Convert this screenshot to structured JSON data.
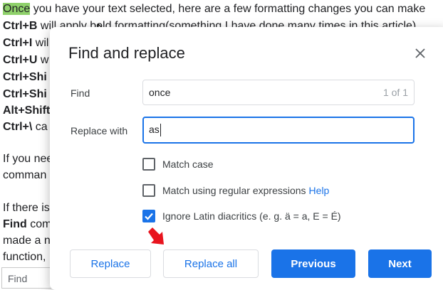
{
  "document": {
    "lines": [
      {
        "bold": "",
        "highlight": "Once",
        "text": " you have your text selected, here are a few formatting changes you can make"
      },
      {
        "bold": "Ctrl+B",
        "highlight": "",
        "text": " will apply bold formatting(something I have done many times in this article)."
      },
      {
        "bold": "Ctrl+I",
        "highlight": "",
        "text": " wil"
      },
      {
        "bold": "Ctrl+U",
        "highlight": "",
        "text": " w"
      },
      {
        "bold": "Ctrl+Shi",
        "highlight": "",
        "text": ""
      },
      {
        "bold": "Ctrl+Shi",
        "highlight": "",
        "text": ""
      },
      {
        "bold": "Alt+Shift",
        "highlight": "",
        "text": ""
      },
      {
        "bold": "Ctrl+\\",
        "highlight": "",
        "text": " ca"
      },
      {
        "bold": "",
        "highlight": "",
        "text": "If you nee"
      },
      {
        "bold": "",
        "highlight": "",
        "text": "comman"
      },
      {
        "bold": "",
        "highlight": "",
        "text": "If there is"
      },
      {
        "bold": "Find",
        "highlight": "",
        "text": " com"
      },
      {
        "bold": "",
        "highlight": "",
        "text": "made a n"
      },
      {
        "bold": "",
        "highlight": "",
        "text": "function,"
      }
    ],
    "find_box_placeholder": "Find"
  },
  "dialog": {
    "title": "Find and replace",
    "find_label": "Find",
    "find_value": "once",
    "find_count": "1 of 1",
    "replace_label": "Replace with",
    "replace_value": "as",
    "options": [
      {
        "label": "Match case",
        "checked": false,
        "help": ""
      },
      {
        "label": "Match using regular expressions",
        "checked": false,
        "help": "Help"
      },
      {
        "label": "Ignore Latin diacritics (e. g. ä = a, E = É)",
        "checked": true,
        "help": ""
      }
    ],
    "buttons": {
      "replace": "Replace",
      "replace_all": "Replace all",
      "previous": "Previous",
      "next": "Next"
    }
  },
  "colors": {
    "accent": "#1a73e8",
    "highlight": "#8fd16b",
    "annotation_arrow": "#e8141e"
  },
  "icons": {
    "close": "close-icon",
    "checkmark": "checkmark-icon",
    "cursor": "mouse-cursor-icon",
    "annotation": "red-arrow-icon"
  }
}
